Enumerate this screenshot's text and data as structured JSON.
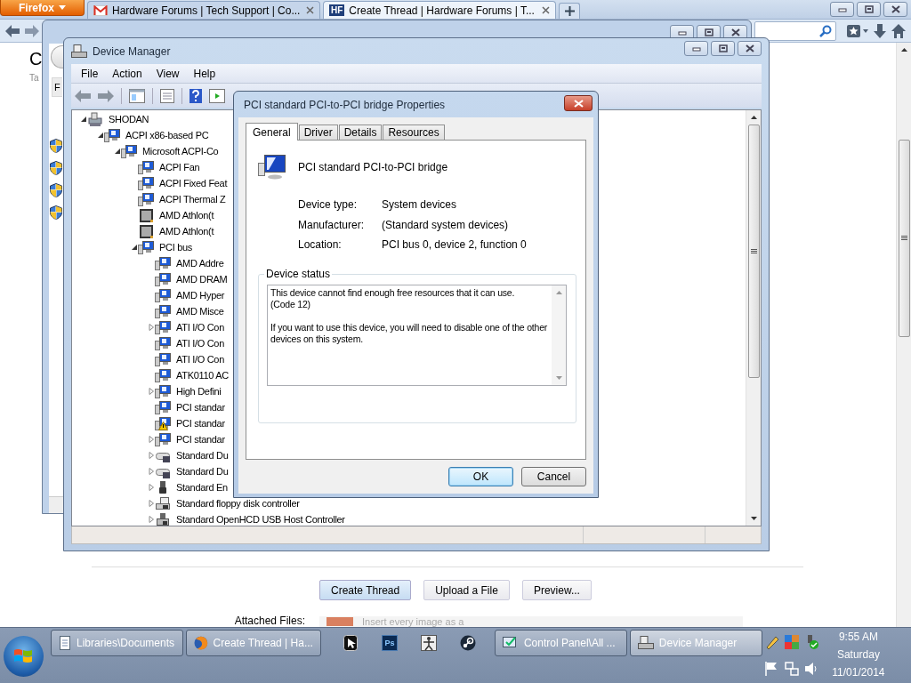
{
  "browser": {
    "menu_button": "Firefox",
    "tabs": [
      {
        "title": "Hardware Forums | Tech Support | Co...",
        "kind": "mail",
        "selected": false
      },
      {
        "title": "Create Thread | Hardware Forums | T...",
        "kind": "site",
        "favicon_text": "HF",
        "selected": true
      }
    ],
    "page": {
      "heading": "C",
      "subtitle": "Ta",
      "buttons": [
        {
          "label": "Create Thread",
          "primary": true
        },
        {
          "label": "Upload a File",
          "primary": false
        },
        {
          "label": "Preview...",
          "primary": false
        }
      ],
      "attached_label": "Attached Files:",
      "attach_hint": "Insert every image as a"
    }
  },
  "background_window": {
    "tab_label": "F"
  },
  "device_manager": {
    "title": "Device Manager",
    "menu": [
      "File",
      "Action",
      "View",
      "Help"
    ],
    "tree": [
      {
        "name": "SHODAN",
        "kind": "computer",
        "expanded": true,
        "warning": false,
        "children": [
          {
            "name": "ACPI x86-based PC",
            "kind": "device",
            "expanded": true,
            "warning": false,
            "children": [
              {
                "name": "Microsoft ACPI-Co",
                "kind": "device",
                "expanded": true,
                "warning": false,
                "children": [
                  {
                    "name": "ACPI Fan",
                    "kind": "device",
                    "warning": false
                  },
                  {
                    "name": "ACPI Fixed Feat",
                    "kind": "device",
                    "warning": false
                  },
                  {
                    "name": "ACPI Thermal Z",
                    "kind": "device",
                    "warning": false
                  },
                  {
                    "name": "AMD Athlon(t",
                    "kind": "cpu",
                    "warning": false
                  },
                  {
                    "name": "AMD Athlon(t",
                    "kind": "cpu",
                    "warning": false
                  },
                  {
                    "name": "PCI bus",
                    "kind": "device",
                    "expanded": true,
                    "warning": false,
                    "children": [
                      {
                        "name": "AMD Addre",
                        "kind": "device",
                        "warning": false
                      },
                      {
                        "name": "AMD DRAM",
                        "kind": "device",
                        "warning": false
                      },
                      {
                        "name": "AMD Hyper",
                        "kind": "device",
                        "warning": false
                      },
                      {
                        "name": "AMD Misce",
                        "kind": "device",
                        "warning": false
                      },
                      {
                        "name": "ATI I/O Con",
                        "kind": "device",
                        "expanded": false,
                        "warning": false
                      },
                      {
                        "name": "ATI I/O Con",
                        "kind": "device",
                        "warning": false
                      },
                      {
                        "name": "ATI I/O Con",
                        "kind": "device",
                        "warning": false
                      },
                      {
                        "name": "ATK0110 AC",
                        "kind": "device",
                        "warning": false
                      },
                      {
                        "name": "High Defini",
                        "kind": "device",
                        "expanded": false,
                        "warning": false
                      },
                      {
                        "name": "PCI standar",
                        "kind": "device",
                        "warning": false
                      },
                      {
                        "name": "PCI standar",
                        "kind": "device",
                        "warning": true
                      },
                      {
                        "name": "PCI standar",
                        "kind": "device",
                        "expanded": false,
                        "warning": false
                      },
                      {
                        "name": "Standard Du",
                        "kind": "disk",
                        "expanded": false,
                        "warning": false
                      },
                      {
                        "name": "Standard Du",
                        "kind": "disk",
                        "expanded": false,
                        "warning": false
                      },
                      {
                        "name": "Standard En",
                        "kind": "plug",
                        "expanded": false,
                        "warning": false
                      },
                      {
                        "name": "Standard floppy disk controller",
                        "kind": "floppy",
                        "expanded": false,
                        "warning": false
                      },
                      {
                        "name": "Standard OpenHCD USB Host Controller",
                        "kind": "controller",
                        "expanded": false,
                        "warning": false
                      }
                    ]
                  }
                ]
              }
            ]
          }
        ]
      }
    ]
  },
  "dialog": {
    "title": "PCI standard PCI-to-PCI bridge Properties",
    "tabs": [
      {
        "label": "General",
        "selected": true
      },
      {
        "label": "Driver",
        "selected": false
      },
      {
        "label": "Details",
        "selected": false
      },
      {
        "label": "Resources",
        "selected": false
      }
    ],
    "device_name": "PCI standard PCI-to-PCI bridge",
    "properties": [
      {
        "label": "Device type:",
        "value": "System devices"
      },
      {
        "label": "Manufacturer:",
        "value": "(Standard system devices)"
      },
      {
        "label": "Location:",
        "value": "PCI bus 0, device 2, function 0"
      }
    ],
    "status_group": "Device status",
    "status_text": "This device cannot find enough free resources that it can use.\n(Code 12)\n\nIf you want to use this device, you will need to disable one of the other devices on this system.",
    "buttons": [
      {
        "label": "OK",
        "default": true
      },
      {
        "label": "Cancel",
        "default": false
      }
    ]
  },
  "taskbar": {
    "windows_left": [
      {
        "label": "Libraries\\Documents",
        "kind": "folder",
        "selected": false
      },
      {
        "label": "Create Thread | Ha...",
        "kind": "firefox",
        "selected": false
      }
    ],
    "pinned": [
      {
        "kind": "cursor"
      },
      {
        "kind": "ps",
        "text": "Ps"
      },
      {
        "kind": "figure"
      },
      {
        "kind": "steam"
      }
    ],
    "windows_right": [
      {
        "label": "Control Panel\\All ...",
        "kind": "panel",
        "selected": false
      },
      {
        "label": "Device Manager",
        "kind": "device",
        "selected": true
      }
    ],
    "clock": {
      "time": "9:55 AM",
      "day": "Saturday",
      "date": "11/01/2014"
    }
  }
}
